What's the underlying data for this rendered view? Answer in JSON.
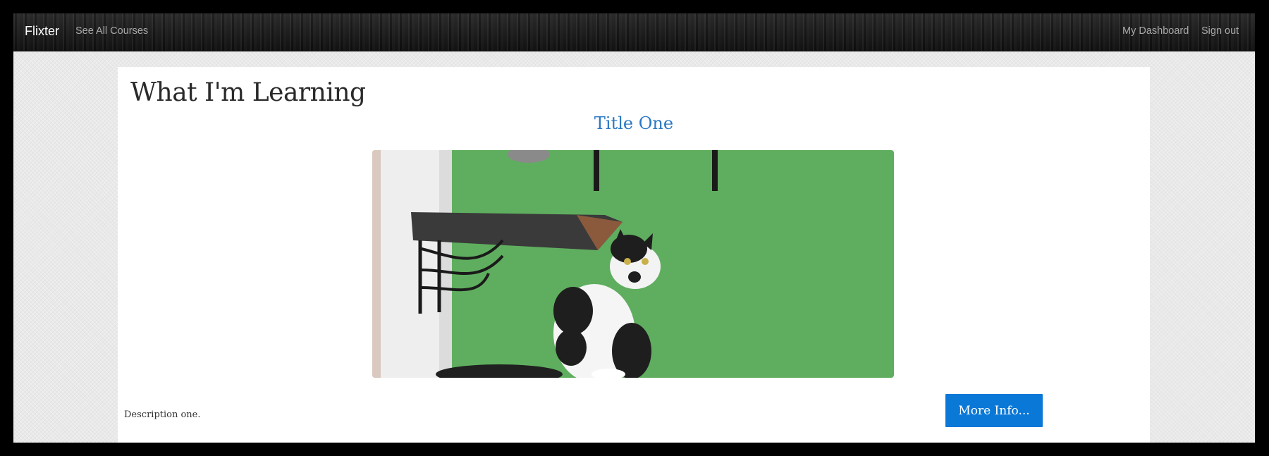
{
  "navbar": {
    "brand": "Flixter",
    "see_all_courses": "See All Courses",
    "my_dashboard": "My Dashboard",
    "sign_out": "Sign out"
  },
  "page": {
    "title": "What I'm Learning"
  },
  "courses": [
    {
      "title": "Title One",
      "image_alt": "cat sitting under wall shelves against a green wall",
      "description": "Description one.",
      "more_info_label": "More Info..."
    }
  ],
  "colors": {
    "accent": "#0a78d7",
    "course_title": "#2a78c4",
    "navbar": "#1c1c1c",
    "background": "#e9e9e9"
  }
}
